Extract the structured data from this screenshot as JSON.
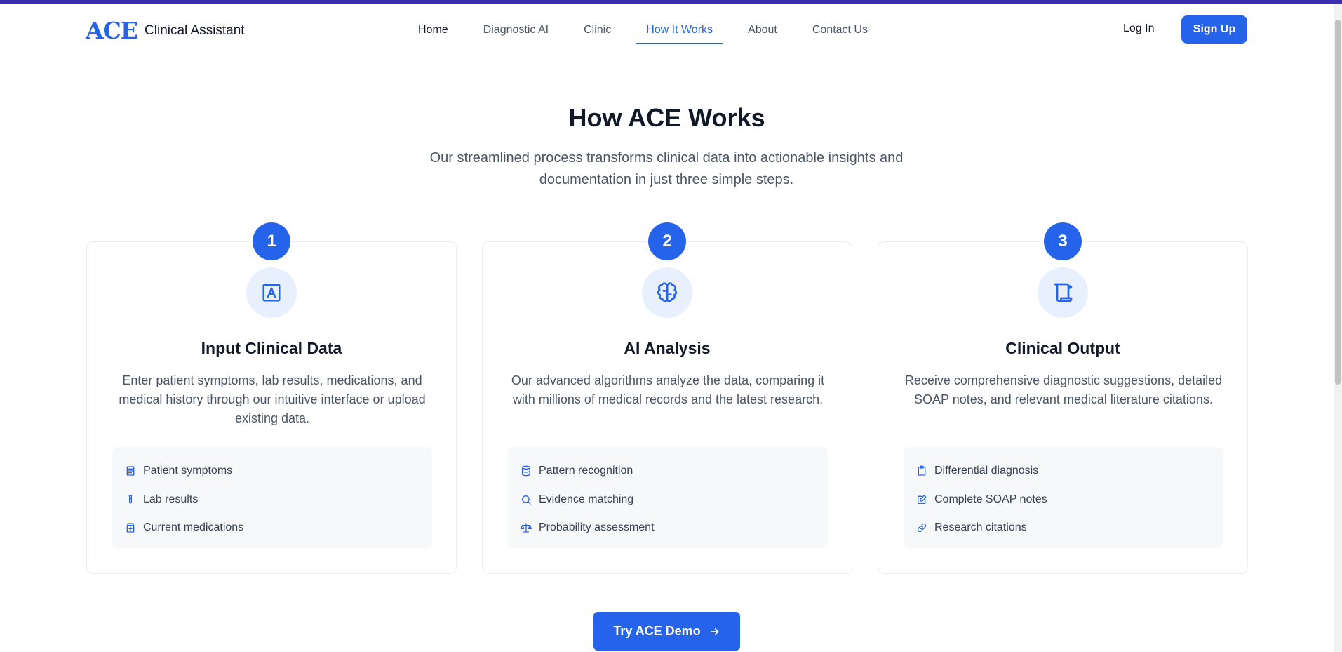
{
  "brand": {
    "logo": "ACE",
    "name": "Clinical Assistant"
  },
  "nav": {
    "items": [
      {
        "label": "Home"
      },
      {
        "label": "Diagnostic AI"
      },
      {
        "label": "Clinic"
      },
      {
        "label": "How It Works"
      },
      {
        "label": "About"
      },
      {
        "label": "Contact Us"
      }
    ],
    "active": "How It Works",
    "login_label": "Log In",
    "signup_label": "Sign Up"
  },
  "section": {
    "title": "How ACE Works",
    "subtitle": "Our streamlined process transforms clinical data into actionable insights and documentation in just three simple steps."
  },
  "steps": [
    {
      "number": "1",
      "icon": "text-input-icon",
      "title": "Input Clinical Data",
      "description": "Enter patient symptoms, lab results, medications, and medical history through our intuitive interface or upload existing data.",
      "features": [
        {
          "icon": "document-icon",
          "label": "Patient symptoms"
        },
        {
          "icon": "test-tube-icon",
          "label": "Lab results"
        },
        {
          "icon": "pill-bottle-icon",
          "label": "Current medications"
        }
      ]
    },
    {
      "number": "2",
      "icon": "brain-icon",
      "title": "AI Analysis",
      "description": "Our advanced algorithms analyze the data, comparing it with millions of medical records and the latest research.",
      "features": [
        {
          "icon": "database-icon",
          "label": "Pattern recognition"
        },
        {
          "icon": "search-icon",
          "label": "Evidence matching"
        },
        {
          "icon": "scale-icon",
          "label": "Probability assessment"
        }
      ]
    },
    {
      "number": "3",
      "icon": "scroll-icon",
      "title": "Clinical Output",
      "description": "Receive comprehensive diagnostic suggestions, detailed SOAP notes, and relevant medical literature citations.",
      "features": [
        {
          "icon": "clipboard-icon",
          "label": "Differential diagnosis"
        },
        {
          "icon": "edit-note-icon",
          "label": "Complete SOAP notes"
        },
        {
          "icon": "link-icon",
          "label": "Research citations"
        }
      ]
    }
  ],
  "cta": {
    "label": "Try ACE Demo",
    "icon": "arrow-right-icon"
  },
  "colors": {
    "accent": "#2563eb",
    "top_bar": "#3b2fb0",
    "icon_bg": "#e8effd"
  }
}
